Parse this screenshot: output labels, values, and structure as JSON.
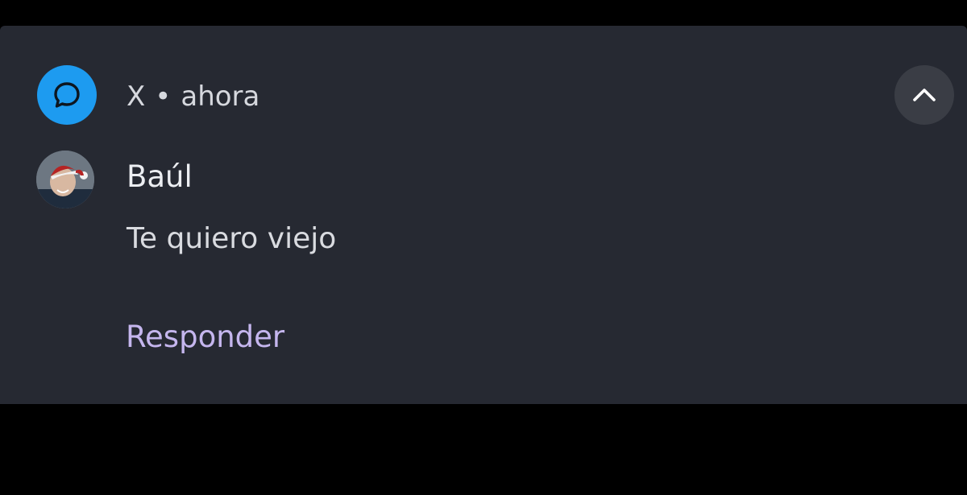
{
  "notification": {
    "app_name": "X",
    "separator": "•",
    "time": "ahora",
    "app_icon": "chat-bubble-icon",
    "collapse_icon": "chevron-up-icon",
    "sender": "Baúl",
    "avatar_description": "avatar",
    "message": "Te quiero viejo",
    "reply_label": "Responder"
  },
  "colors": {
    "page_background": "#000000",
    "card_background": "#262932",
    "app_icon_background": "#1d9bf0",
    "collapse_button_background": "#3a3d45",
    "primary_text": "#eceef2",
    "secondary_text": "#d6d8de",
    "reply_text": "#c5b6ee"
  }
}
